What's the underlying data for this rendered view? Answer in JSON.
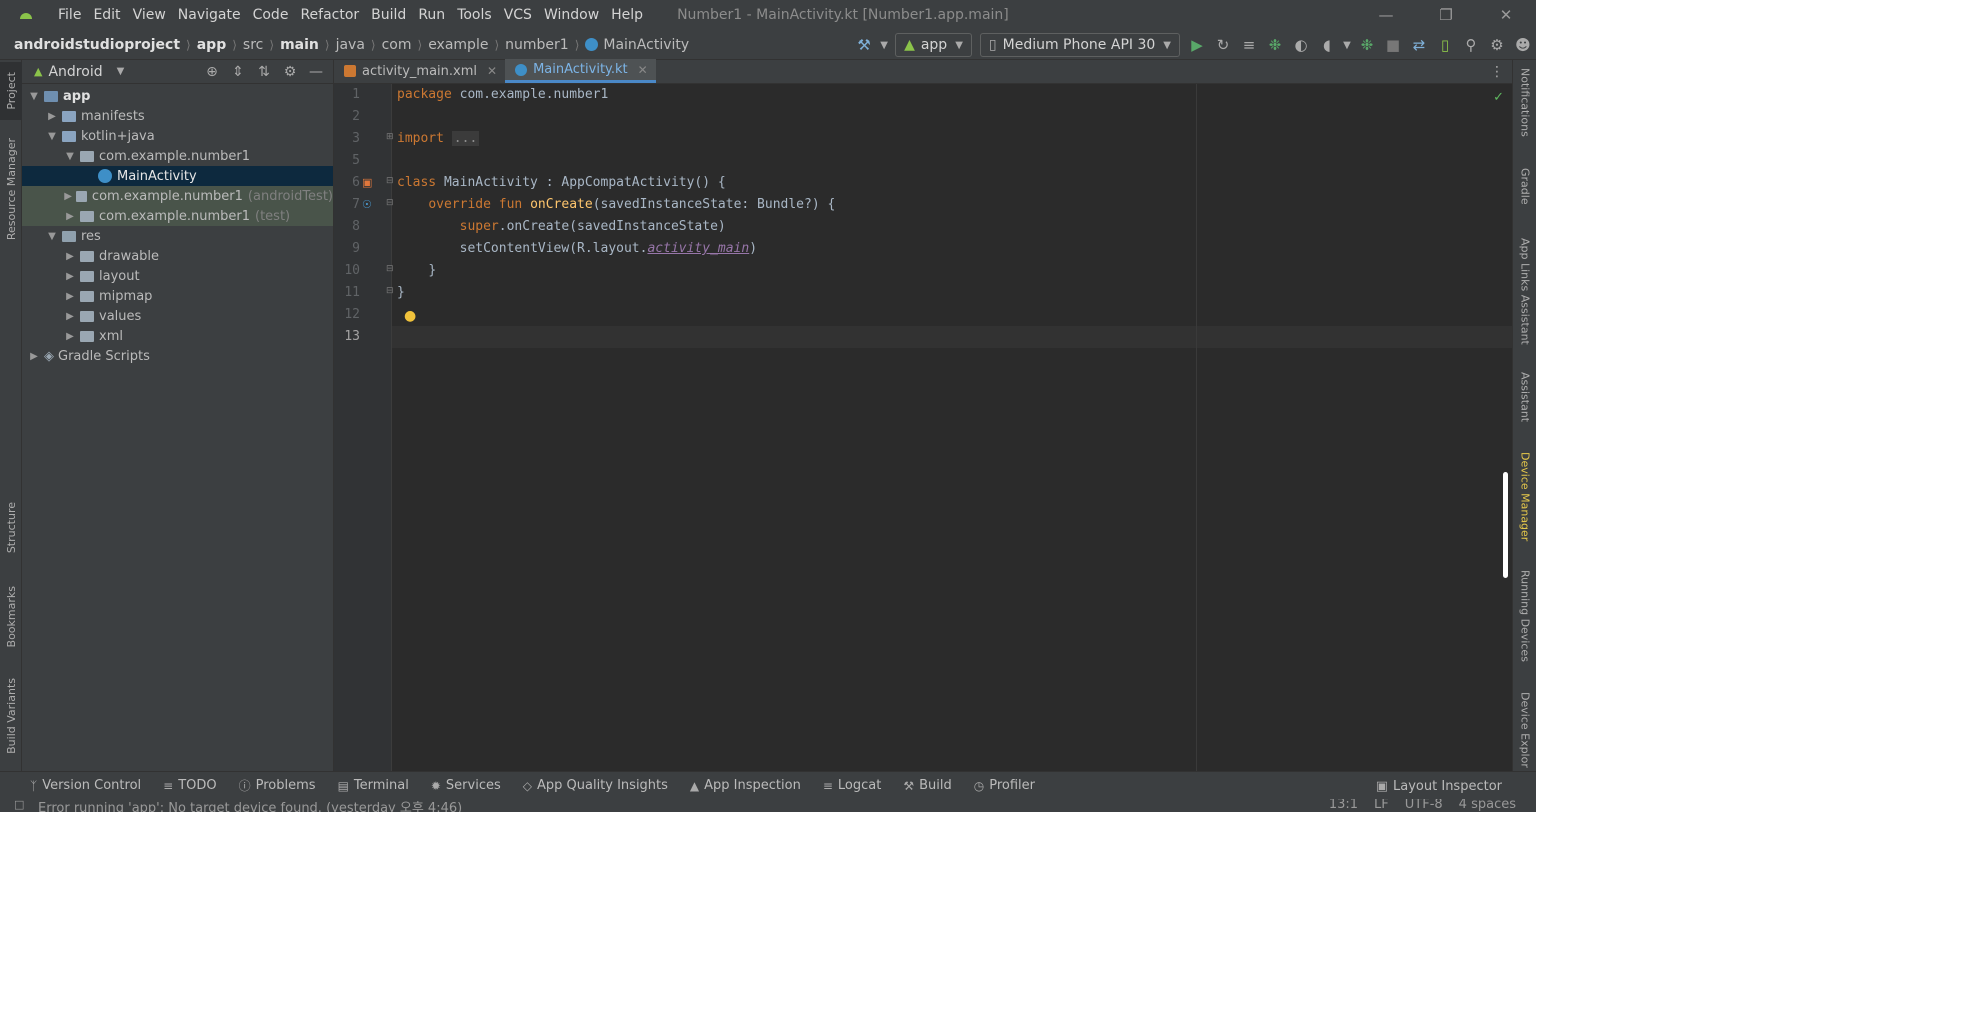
{
  "window": {
    "title": "Number1 - MainActivity.kt [Number1.app.main]",
    "menu": [
      "File",
      "Edit",
      "View",
      "Navigate",
      "Code",
      "Refactor",
      "Build",
      "Run",
      "Tools",
      "VCS",
      "Window",
      "Help"
    ]
  },
  "breadcrumbs": [
    "androidstudioproject",
    "app",
    "src",
    "main",
    "java",
    "com",
    "example",
    "number1",
    "MainActivity"
  ],
  "run_toolbar": {
    "config": "app",
    "device": "Medium Phone API 30"
  },
  "project_panel": {
    "view_mode": "Android",
    "tree": [
      {
        "label": "app",
        "suffix": "",
        "depth": 0,
        "expanded": true,
        "kind": "module"
      },
      {
        "label": "manifests",
        "suffix": "",
        "depth": 1,
        "expanded": false,
        "kind": "folder"
      },
      {
        "label": "kotlin+java",
        "suffix": "",
        "depth": 1,
        "expanded": true,
        "kind": "folder"
      },
      {
        "label": "com.example.number1",
        "suffix": "",
        "depth": 2,
        "expanded": true,
        "kind": "package"
      },
      {
        "label": "MainActivity",
        "suffix": "",
        "depth": 3,
        "expanded": null,
        "kind": "kotlin"
      },
      {
        "label": "com.example.number1",
        "suffix": "(androidTest)",
        "depth": 2,
        "expanded": false,
        "kind": "package"
      },
      {
        "label": "com.example.number1",
        "suffix": "(test)",
        "depth": 2,
        "expanded": false,
        "kind": "package"
      },
      {
        "label": "res",
        "suffix": "",
        "depth": 1,
        "expanded": true,
        "kind": "folder"
      },
      {
        "label": "drawable",
        "suffix": "",
        "depth": 2,
        "expanded": false,
        "kind": "folder"
      },
      {
        "label": "layout",
        "suffix": "",
        "depth": 2,
        "expanded": false,
        "kind": "folder"
      },
      {
        "label": "mipmap",
        "suffix": "",
        "depth": 2,
        "expanded": false,
        "kind": "folder"
      },
      {
        "label": "values",
        "suffix": "",
        "depth": 2,
        "expanded": false,
        "kind": "folder"
      },
      {
        "label": "xml",
        "suffix": "",
        "depth": 2,
        "expanded": false,
        "kind": "folder"
      },
      {
        "label": "Gradle Scripts",
        "suffix": "",
        "depth": 0,
        "expanded": false,
        "kind": "gradle"
      }
    ]
  },
  "editor": {
    "tabs": [
      {
        "label": "activity_main.xml",
        "active": false
      },
      {
        "label": "MainActivity.kt",
        "active": true
      }
    ],
    "line_numbers": [
      "1",
      "2",
      "3",
      "5",
      "6",
      "7",
      "8",
      "9",
      "10",
      "11",
      "12",
      "13"
    ],
    "code": {
      "l1_kw": "package",
      "l1_rest": " com.example.number1",
      "l3_kw": "import",
      "l3_fold": "...",
      "l6_kw": "class",
      "l6_rest": " MainActivity : AppCompatActivity() {",
      "l7_kw": "override fun",
      "l7_fn": "onCreate",
      "l7_rest": "(savedInstanceState: Bundle?) {",
      "l8_kw": "super",
      "l8_rest": ".onCreate(savedInstanceState)",
      "l9_a": "setContentView(R.layout.",
      "l9_ref": "activity_main",
      "l9_b": ")",
      "l10": "}",
      "l11": "}"
    }
  },
  "left_tool_tabs": [
    "Project",
    "Resource Manager",
    "Structure",
    "Bookmarks",
    "Build Variants"
  ],
  "right_tool_tabs": [
    "Notifications",
    "Gradle",
    "App Links Assistant",
    "Assistant",
    "Device Manager",
    "Running Devices",
    "Device Explor"
  ],
  "bottom_tools": [
    "Version Control",
    "TODO",
    "Problems",
    "Terminal",
    "Services",
    "App Quality Insights",
    "App Inspection",
    "Logcat",
    "Build",
    "Profiler"
  ],
  "layout_inspector": "Layout Inspector",
  "status": {
    "message": "Error running 'app': No target device found. (yesterday 오후 4:46)",
    "position": "13:1",
    "line_sep": "LF",
    "encoding": "UTF-8",
    "indent": "4 spaces"
  },
  "colors": {
    "accent": "#4a88c7",
    "selection": "#0d293e",
    "keyword": "#cc7832",
    "function": "#ffc66d",
    "highlight_tab": "#e6c84a"
  }
}
